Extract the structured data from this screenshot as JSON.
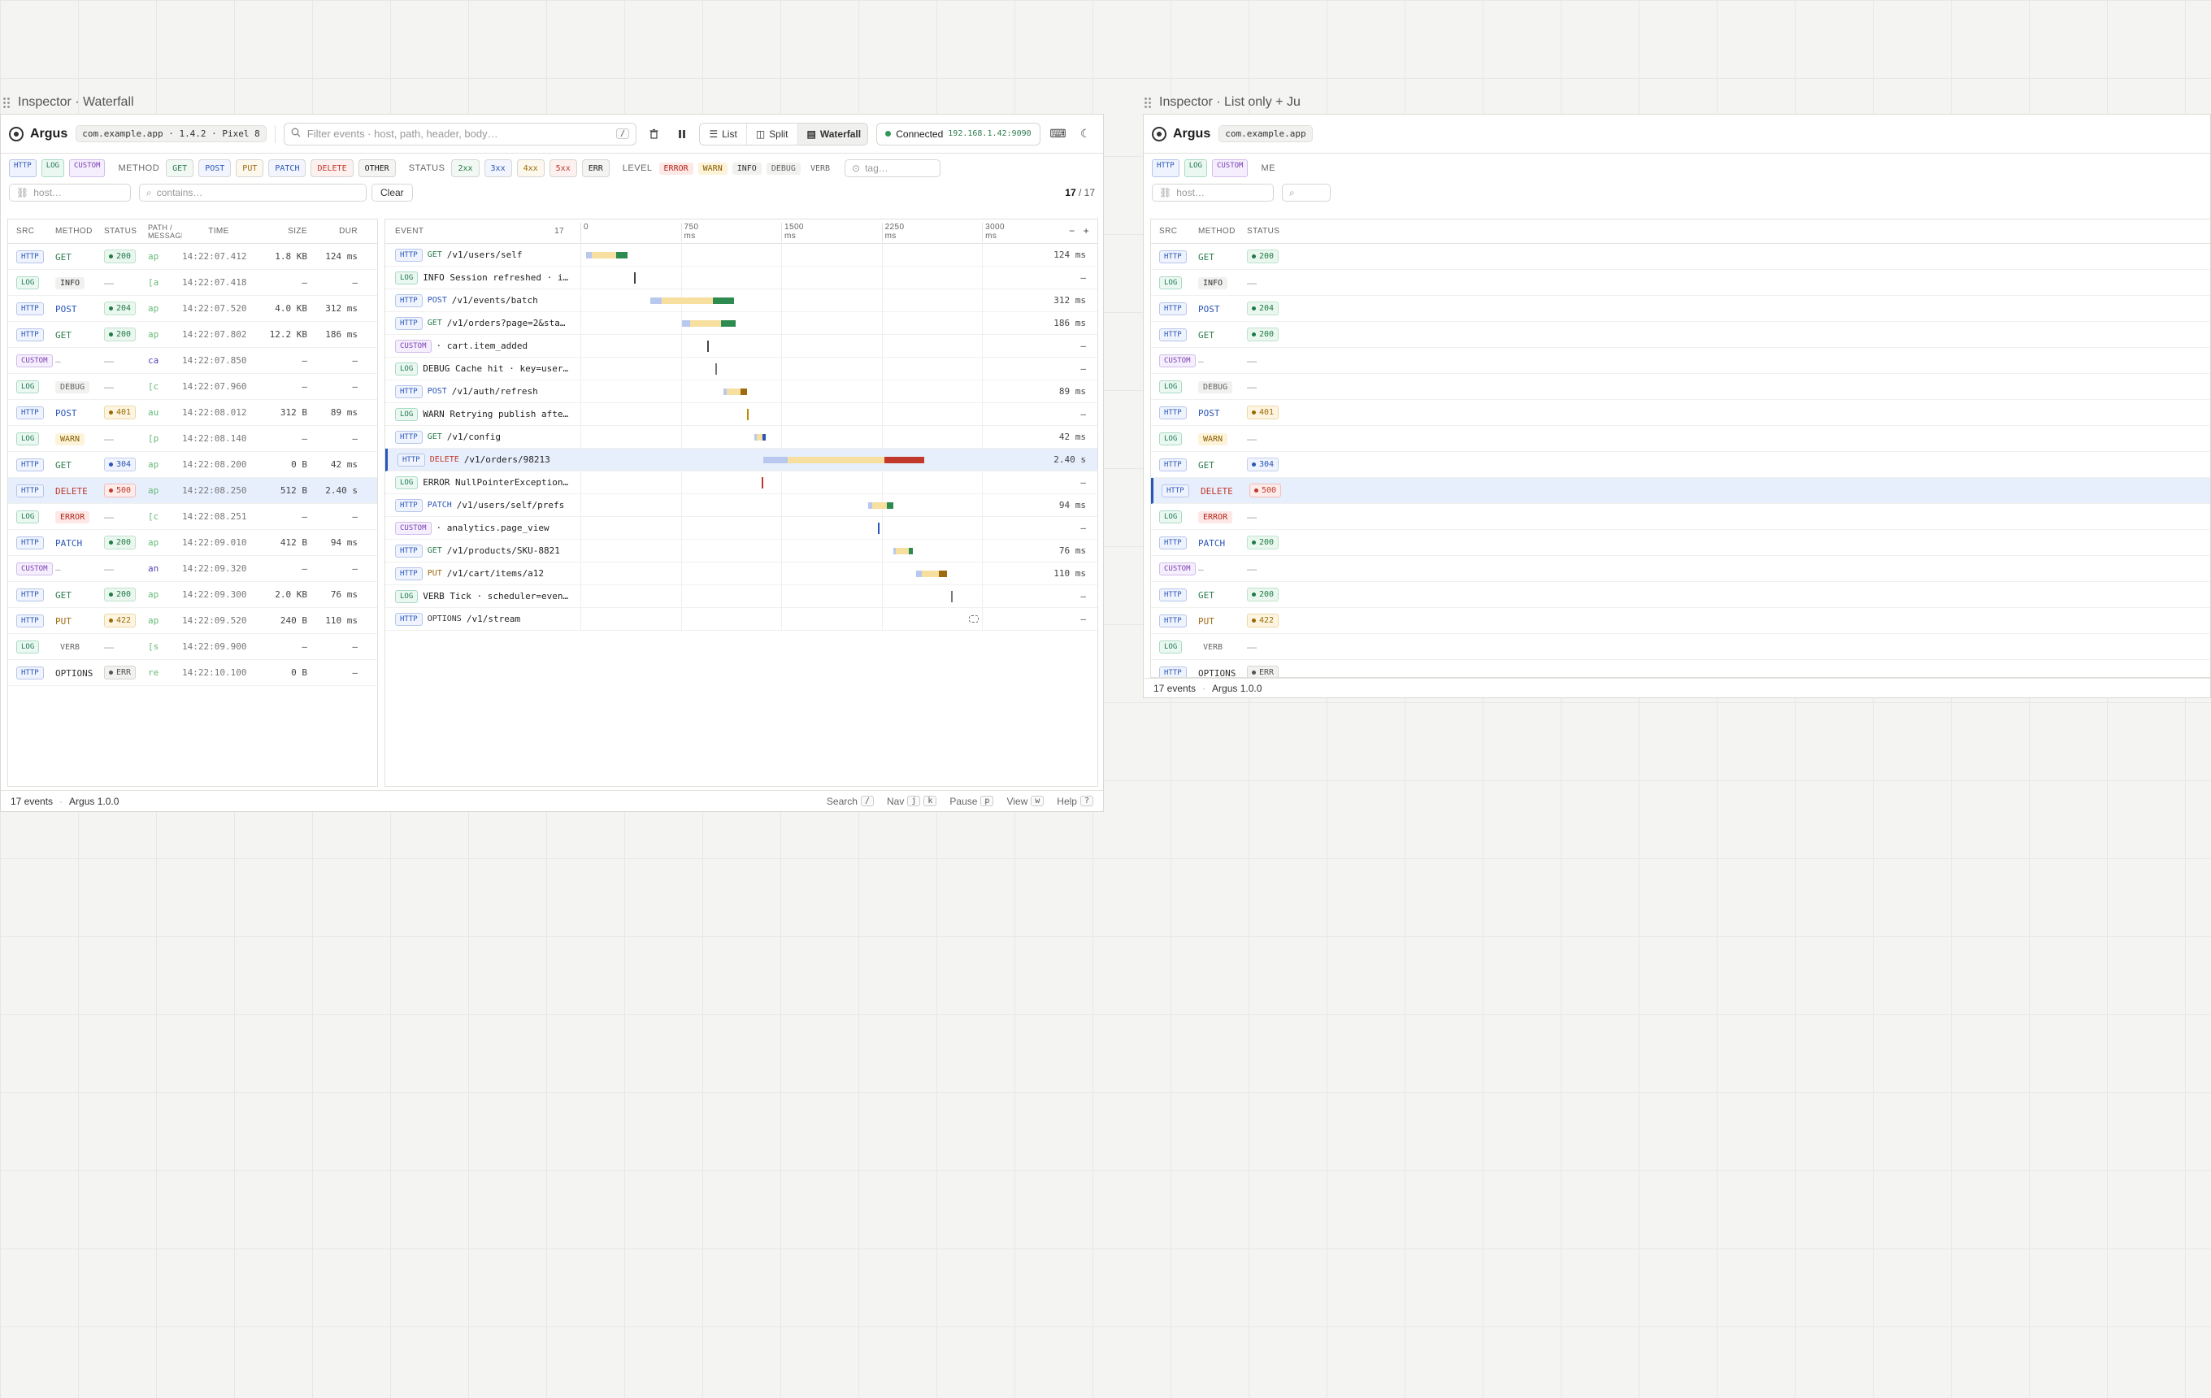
{
  "frames": {
    "waterfall_title": "Inspector · Waterfall",
    "list_title": "Inspector · List only + Ju"
  },
  "app": {
    "name": "Argus",
    "device": "com.example.app · 1.4.2 · Pixel 8",
    "device_short": "com.example.app",
    "search_placeholder": "Filter events · host, path, header, body…",
    "search_kbd": "/",
    "views": [
      "List",
      "Split",
      "Waterfall"
    ],
    "connected_label": "Connected",
    "connected_ip": "192.168.1.42:9090"
  },
  "filters": {
    "sources": [
      "HTTP",
      "LOG",
      "CUSTOM"
    ],
    "method_label": "METHOD",
    "methods": [
      "GET",
      "POST",
      "PUT",
      "PATCH",
      "DELETE",
      "OTHER"
    ],
    "status_label": "STATUS",
    "statuses": [
      "2xx",
      "3xx",
      "4xx",
      "5xx",
      "ERR"
    ],
    "level_label": "LEVEL",
    "levels": [
      "ERROR",
      "WARN",
      "INFO",
      "DEBUG",
      "VERB"
    ],
    "tag_placeholder": "tag…",
    "host_placeholder": "host…",
    "contains_placeholder": "contains…",
    "clear_label": "Clear",
    "count_shown": "17",
    "count_total": "/ 17",
    "list_me": "ME"
  },
  "table": {
    "headers": [
      "SRC",
      "METHOD",
      "STATUS",
      "PATH / MESSAGE",
      "TIME",
      "SIZE",
      "DUR"
    ],
    "rows": [
      {
        "src": "HTTP",
        "method": "GET",
        "status": "200",
        "path": "ap",
        "time": "14:22:07.412",
        "size": "1.8 KB",
        "dur": "124 ms"
      },
      {
        "src": "LOG",
        "level": "INFO",
        "status": "—",
        "path": "[a",
        "time": "14:22:07.418",
        "size": "—",
        "dur": "—"
      },
      {
        "src": "HTTP",
        "method": "POST",
        "status": "204",
        "path": "ap",
        "time": "14:22:07.520",
        "size": "4.0 KB",
        "dur": "312 ms"
      },
      {
        "src": "HTTP",
        "method": "GET",
        "status": "200",
        "path": "ap",
        "time": "14:22:07.802",
        "size": "12.2 KB",
        "dur": "186 ms"
      },
      {
        "src": "CUSTOM",
        "method": "—",
        "status": "—",
        "path": "ca",
        "time": "14:22:07.850",
        "size": "—",
        "dur": "—"
      },
      {
        "src": "LOG",
        "level": "DEBUG",
        "status": "—",
        "path": "[c",
        "time": "14:22:07.960",
        "size": "—",
        "dur": "—"
      },
      {
        "src": "HTTP",
        "method": "POST",
        "status": "401",
        "path": "au",
        "time": "14:22:08.012",
        "size": "312 B",
        "dur": "89 ms"
      },
      {
        "src": "LOG",
        "level": "WARN",
        "status": "—",
        "path": "[p",
        "time": "14:22:08.140",
        "size": "—",
        "dur": "—"
      },
      {
        "src": "HTTP",
        "method": "GET",
        "status": "304",
        "path": "ap",
        "time": "14:22:08.200",
        "size": "0 B",
        "dur": "42 ms"
      },
      {
        "src": "HTTP",
        "method": "DELETE",
        "status": "500",
        "path": "ap",
        "time": "14:22:08.250",
        "size": "512 B",
        "dur": "2.40 s",
        "selected": true
      },
      {
        "src": "LOG",
        "level": "ERROR",
        "status": "—",
        "path": "[c",
        "time": "14:22:08.251",
        "size": "—",
        "dur": "—"
      },
      {
        "src": "HTTP",
        "method": "PATCH",
        "status": "200",
        "path": "ap",
        "time": "14:22:09.010",
        "size": "412 B",
        "dur": "94 ms"
      },
      {
        "src": "CUSTOM",
        "method": "—",
        "status": "—",
        "path": "an",
        "time": "14:22:09.320",
        "size": "—",
        "dur": "—"
      },
      {
        "src": "HTTP",
        "method": "GET",
        "status": "200",
        "path": "ap",
        "time": "14:22:09.300",
        "size": "2.0 KB",
        "dur": "76 ms"
      },
      {
        "src": "HTTP",
        "method": "PUT",
        "status": "422",
        "path": "ap",
        "time": "14:22:09.520",
        "size": "240 B",
        "dur": "110 ms"
      },
      {
        "src": "LOG",
        "level": "VERB",
        "status": "—",
        "path": "[s",
        "time": "14:22:09.900",
        "size": "—",
        "dur": "—"
      },
      {
        "src": "HTTP",
        "method": "OPTIONS",
        "status": "ERR",
        "path": "re",
        "time": "14:22:10.100",
        "size": "0 B",
        "dur": "—"
      }
    ]
  },
  "waterfall": {
    "header": "EVENT",
    "count": "17",
    "axis": [
      "0",
      "750 ms",
      "1500 ms",
      "2250 ms",
      "3000 ms"
    ],
    "axis_range_ms": [
      0,
      3400
    ],
    "zoom": [
      "−",
      "+"
    ],
    "rows": [
      {
        "src": "HTTP",
        "method": "GET",
        "text": "/v1/users/self",
        "dur": "124 ms",
        "start": 40,
        "phases": [
          45,
          180,
          90
        ],
        "end": "#2e8b4f"
      },
      {
        "src": "LOG",
        "text": "INFO Session refreshed · i…",
        "dur": "—",
        "mark": 400,
        "color": "#444"
      },
      {
        "src": "HTTP",
        "method": "POST",
        "text": "/v1/events/batch",
        "dur": "312 ms",
        "start": 520,
        "phases": [
          90,
          380,
          160
        ],
        "end": "#2e8b4f"
      },
      {
        "src": "HTTP",
        "method": "GET",
        "text": "/v1/orders?page=2&sta…",
        "dur": "186 ms",
        "start": 760,
        "phases": [
          60,
          230,
          110
        ],
        "end": "#2e8b4f"
      },
      {
        "src": "CUSTOM",
        "text": "· cart.item_added",
        "dur": "—",
        "mark": 945,
        "color": "#444"
      },
      {
        "src": "LOG",
        "text": "DEBUG Cache hit · key=user…",
        "dur": "—",
        "mark": 1005,
        "color": "#777"
      },
      {
        "src": "HTTP",
        "method": "POST",
        "text": "/v1/auth/refresh",
        "dur": "89 ms",
        "start": 1070,
        "phases": [
          25,
          100,
          50
        ],
        "end": "#a06a10"
      },
      {
        "src": "LOG",
        "text": "WARN Retrying publish afte…",
        "dur": "—",
        "mark": 1245,
        "color": "#c08a00"
      },
      {
        "src": "HTTP",
        "method": "GET",
        "text": "/v1/config",
        "dur": "42 ms",
        "start": 1300,
        "phases": [
          20,
          40,
          25
        ],
        "end": "#2a55b8"
      },
      {
        "src": "HTTP",
        "method": "DELETE",
        "text": "/v1/orders/98213",
        "dur": "2.40 s",
        "start": 1350,
        "phases": [
          180,
          720,
          300
        ],
        "end": "#c0392b",
        "selected": true
      },
      {
        "src": "LOG",
        "text": "ERROR NullPointerException…",
        "dur": "—",
        "mark": 1352,
        "color": "#c0392b"
      },
      {
        "src": "HTTP",
        "method": "PATCH",
        "text": "/v1/users/self/prefs",
        "dur": "94 ms",
        "start": 2150,
        "phases": [
          30,
          110,
          50
        ],
        "end": "#2e8b4f"
      },
      {
        "src": "CUSTOM",
        "text": "· analytics.page_view",
        "dur": "—",
        "mark": 2220,
        "color": "#2a55b8"
      },
      {
        "src": "HTTP",
        "method": "GET",
        "text": "/v1/products/SKU-8821",
        "dur": "76 ms",
        "start": 2340,
        "phases": [
          15,
          100,
          30
        ],
        "end": "#2e8b4f"
      },
      {
        "src": "HTTP",
        "method": "PUT",
        "text": "/v1/cart/items/a12",
        "dur": "110 ms",
        "start": 2510,
        "phases": [
          40,
          130,
          60
        ],
        "end": "#a06a10"
      },
      {
        "src": "LOG",
        "text": "VERB Tick · scheduler=even…",
        "dur": "—",
        "mark": 2770,
        "color": "#777"
      },
      {
        "src": "HTTP",
        "method": "OPTIONS",
        "text": "/v1/stream",
        "dur": "—",
        "pending": 2900
      }
    ]
  },
  "statusbar": {
    "events": "17 events",
    "version": "Argus 1.0.0",
    "shortcuts": [
      {
        "label": "Search",
        "key": "/"
      },
      {
        "label": "Nav",
        "key": "j",
        "key2": "k"
      },
      {
        "label": "Pause",
        "key": "p"
      },
      {
        "label": "View",
        "key": "w"
      },
      {
        "label": "Help",
        "key": "?"
      }
    ]
  },
  "colors": {
    "waiting": "#b9c8ee",
    "receiving": "#f7dfa0"
  }
}
